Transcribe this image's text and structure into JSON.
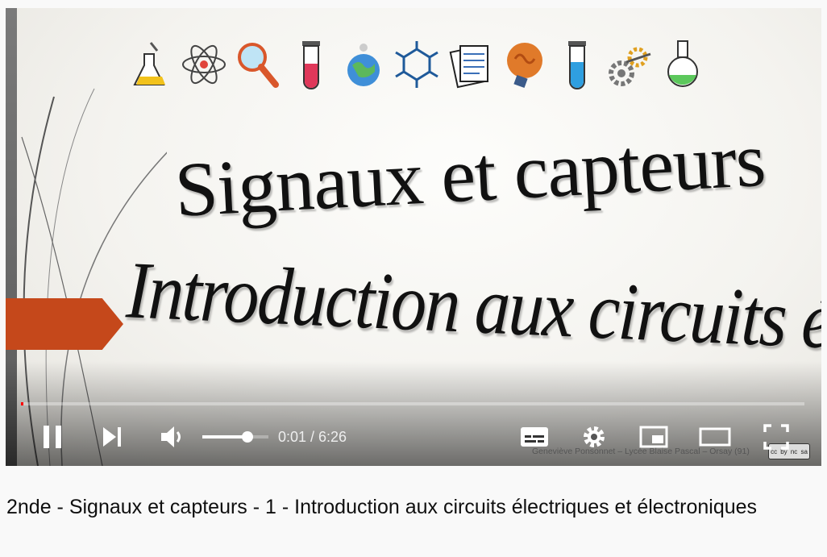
{
  "video": {
    "slide": {
      "title": "Signaux et capteurs",
      "subtitle": "Introduction aux circuits électriq",
      "icons": [
        "flask-icon",
        "atom-icon",
        "magnifier-icon",
        "test-tube-icon",
        "globe-icon",
        "molecule-icon",
        "notes-icon",
        "brain-bulb-icon",
        "test-tube-blue-icon",
        "gears-icon",
        "round-flask-icon"
      ],
      "credit": "Geneviève Ponsonnet – Lycée Blaise Pascal – Orsay (91)",
      "license_badge": [
        "cc",
        "by",
        "nc",
        "sa"
      ]
    },
    "progress": {
      "fraction": 0.003
    },
    "controls": {
      "time": "0:01 / 6:26",
      "volume_level": 0.68
    }
  },
  "title": "2nde - Signaux et capteurs - 1 - Introduction aux circuits électriques et électroniques",
  "colors": {
    "accent_progress": "#ff0000",
    "arrow": "#c5481b"
  }
}
